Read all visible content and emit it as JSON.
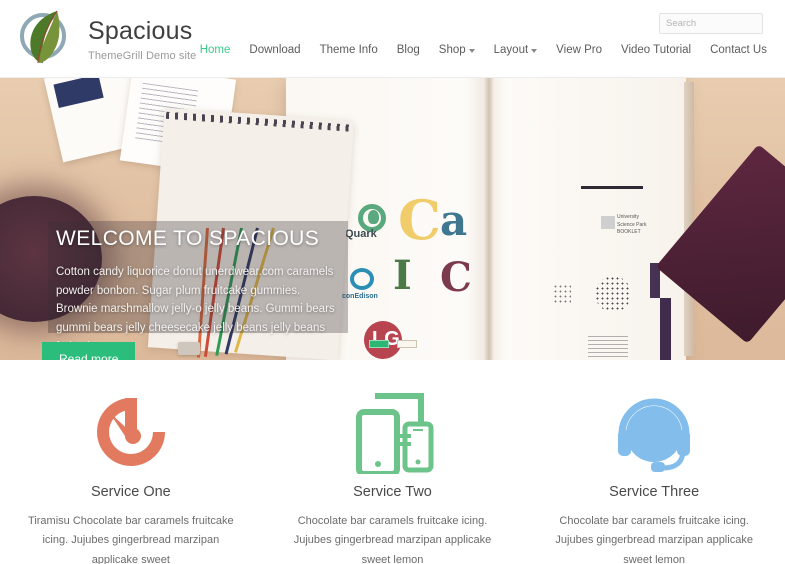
{
  "header": {
    "site_title": "Spacious",
    "site_description": "ThemeGrill Demo site",
    "logo_icon": "leaf-in-circle-logo",
    "search": {
      "placeholder": "Search",
      "value": "",
      "button_icon": "search-icon",
      "button_color": "#2bb673"
    },
    "nav": [
      {
        "label": "Home",
        "active": true,
        "has_dropdown": false
      },
      {
        "label": "Download",
        "active": false,
        "has_dropdown": false
      },
      {
        "label": "Theme Info",
        "active": false,
        "has_dropdown": false
      },
      {
        "label": "Blog",
        "active": false,
        "has_dropdown": false
      },
      {
        "label": "Shop",
        "active": false,
        "has_dropdown": true
      },
      {
        "label": "Layout",
        "active": false,
        "has_dropdown": true
      },
      {
        "label": "View Pro",
        "active": false,
        "has_dropdown": false
      },
      {
        "label": "Video Tutorial",
        "active": false,
        "has_dropdown": false
      },
      {
        "label": "Contact Us",
        "active": false,
        "has_dropdown": false
      }
    ],
    "active_color": "#3ec98a"
  },
  "hero": {
    "title": "WELCOME TO SPACIOUS",
    "text": "Cotton candy liquorice donut unerdwear.com caramels powder bonbon. Sugar plum fruitcake gummies. Brownie marshmallow jelly-o jelly beans. Gummi bears gummi bears jelly cheesecake jelly beans jelly beans fruitcake",
    "button_label": "Read more",
    "button_color": "#2bbd7c",
    "slides": [
      {
        "active": true
      },
      {
        "active": false
      }
    ],
    "background_logos": {
      "quark": "Quark",
      "coned": "conEdison",
      "lg": "LG",
      "letter_c_yellow": "C",
      "letter_a_blue": "a",
      "letter_i_green": "I",
      "letter_c_purple": "C"
    },
    "right_page_label": "University\nScience Park\nBOOKLET"
  },
  "services": [
    {
      "icon": "speedometer-icon",
      "icon_color": "#e27a5f",
      "title": "Service One",
      "description": "Tiramisu Chocolate bar caramels fruitcake icing. Jujubes gingerbread marzipan applicake sweet"
    },
    {
      "icon": "responsive-devices-icon",
      "icon_color": "#6cc48a",
      "title": "Service Two",
      "description": "Chocolate bar caramels fruitcake icing. Jujubes gingerbread marzipan applicake sweet lemon"
    },
    {
      "icon": "headset-support-icon",
      "icon_color": "#83bdeb",
      "title": "Service Three",
      "description": "Chocolate bar caramels fruitcake icing. Jujubes gingerbread marzipan applicake sweet lemon"
    }
  ]
}
